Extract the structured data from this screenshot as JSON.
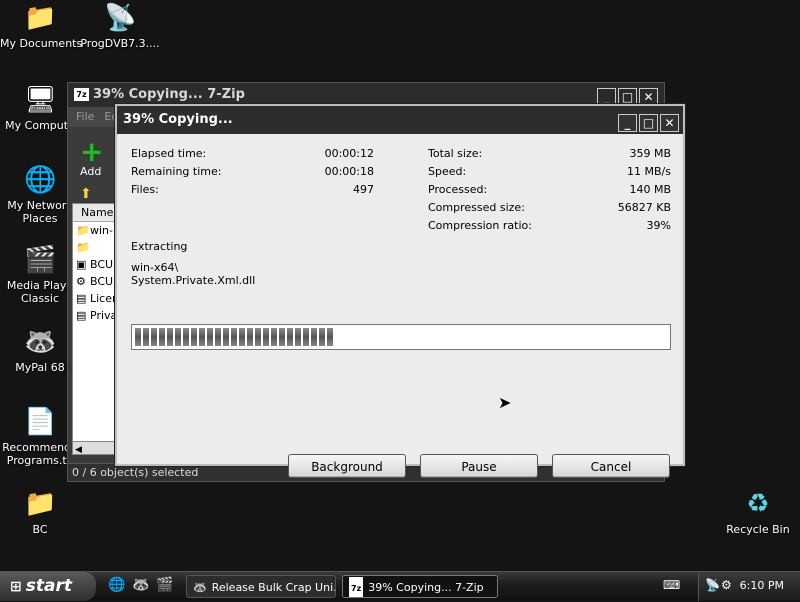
{
  "desktop": {
    "icons": [
      {
        "name": "my-documents",
        "label": "My Documents",
        "glyph": "📁"
      },
      {
        "name": "progdvb",
        "label": "ProgDVB7.3....",
        "glyph": "📡"
      },
      {
        "name": "my-computer",
        "label": "My Compute",
        "glyph": "🖥"
      },
      {
        "name": "my-network-places",
        "label": "My Network Places",
        "glyph": "🌐"
      },
      {
        "name": "media-player-classic",
        "label": "Media Playe Classic",
        "glyph": "🎬"
      },
      {
        "name": "mypal",
        "label": "MyPal 68",
        "glyph": "🦝"
      },
      {
        "name": "recommended-programs",
        "label": "Recommende Programs.tx",
        "glyph": "📄"
      },
      {
        "name": "bc-folder",
        "label": "BC",
        "glyph": "📁"
      },
      {
        "name": "recycle-bin",
        "label": "Recycle Bin",
        "glyph": "♻"
      }
    ]
  },
  "bg_window": {
    "title": "39% Copying... 7-Zip",
    "menu": [
      "File",
      "Ec"
    ],
    "add_label": "Add",
    "column_name": "Name",
    "rows": [
      "win-",
      "",
      "BCU",
      "BCU",
      "Licer",
      "Priva"
    ],
    "status": "0 / 6 object(s) selected"
  },
  "dialog": {
    "title": "39% Copying...",
    "left_stats": [
      {
        "label": "Elapsed time:",
        "value": "00:00:12"
      },
      {
        "label": "Remaining time:",
        "value": "00:00:18"
      },
      {
        "label": "Files:",
        "value": "497"
      }
    ],
    "right_stats": [
      {
        "label": "Total size:",
        "value": "359 MB"
      },
      {
        "label": "Speed:",
        "value": "11 MB/s"
      },
      {
        "label": "Processed:",
        "value": "140 MB"
      },
      {
        "label": "Compressed size:",
        "value": "56827 KB"
      },
      {
        "label": "Compression ratio:",
        "value": "39%"
      }
    ],
    "operation": "Extracting",
    "path_line1": "win-x64\\",
    "path_line2": "System.Private.Xml.dll",
    "progress": 0.39,
    "buttons": {
      "background": "Background",
      "pause": "Pause",
      "cancel": "Cancel"
    }
  },
  "taskbar": {
    "start_label": "start",
    "tasks": [
      {
        "label": "Release Bulk Crap Uni...",
        "active": false
      },
      {
        "label": "39% Copying... 7-Zip",
        "active": true
      }
    ],
    "clock": "6:10 PM"
  },
  "colors": {
    "desktop_bg": "#141414",
    "dialog_bg": "#ececec",
    "add_icon": "#18c21a"
  }
}
